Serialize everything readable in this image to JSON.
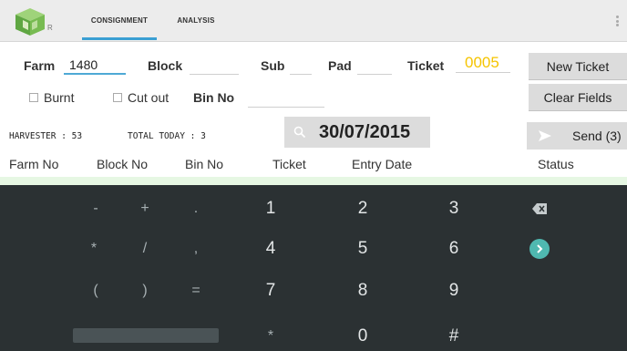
{
  "appbar": {
    "logo_letter": "R",
    "tabs": [
      {
        "label": "CONSIGNMENT",
        "active": true
      },
      {
        "label": "ANALYSIS",
        "active": false
      }
    ],
    "accent_color": "#3a9fd3"
  },
  "form": {
    "farm_label": "Farm",
    "farm_value": "1480",
    "block_label": "Block",
    "block_value": "",
    "sub_label": "Sub",
    "sub_value": "",
    "pad_label": "Pad",
    "pad_value": "",
    "ticket_label": "Ticket",
    "ticket_value": "0005",
    "ticket_color": "#f5c400",
    "burnt_label": "Burnt",
    "burnt_checked": false,
    "cutout_label": "Cut out",
    "cutout_checked": false,
    "binno_label": "Bin No",
    "binno_value": ""
  },
  "buttons": {
    "new_ticket": "New Ticket",
    "clear_fields": "Clear Fields",
    "send": "Send (3)"
  },
  "status_bar": {
    "harvester": "HARVESTER :  53",
    "total_today": "TOTAL TODAY : 3",
    "date": "30/07/2015"
  },
  "table": {
    "headers": [
      "Farm No",
      "Block No",
      "Bin No",
      "Ticket",
      "Entry Date",
      "Status"
    ]
  },
  "keyboard": {
    "rows": [
      [
        "-",
        "+",
        ".",
        "1",
        "2",
        "3"
      ],
      [
        "*",
        "/",
        ",",
        "4",
        "5",
        "6"
      ],
      [
        "(",
        ")",
        "=",
        "7",
        "8",
        "9"
      ],
      [
        "",
        "",
        "",
        "*",
        "0",
        "#"
      ]
    ],
    "backspace_icon": "backspace-icon",
    "next_icon": "next-arrow-icon",
    "next_color": "#4fb8b0"
  }
}
